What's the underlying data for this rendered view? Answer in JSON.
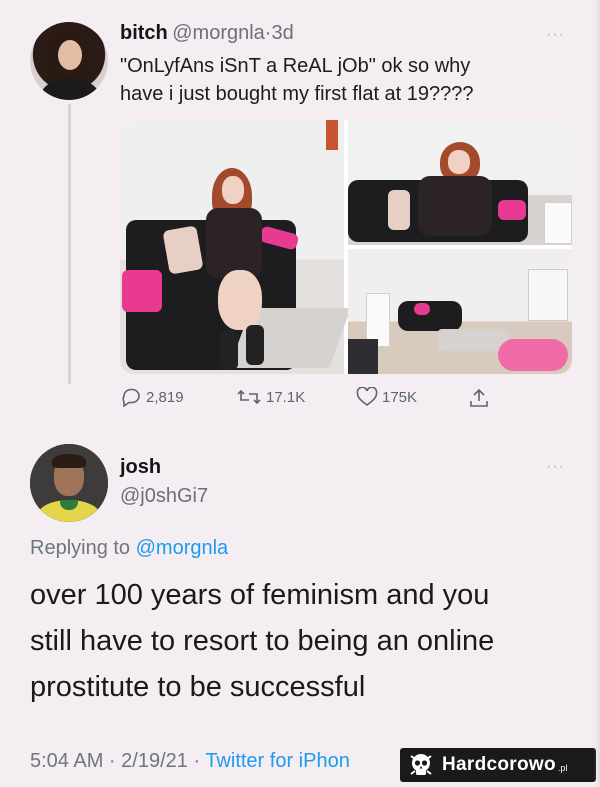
{
  "tweet": {
    "author_name": "bitch",
    "author_handle": "@morgnla",
    "separator": "·",
    "age": "3d",
    "more": "···",
    "text_line1": "\"OnLyfAns iSnT a ReAL jOb\" ok so why",
    "text_line2": "have i just bought my first flat at 19????",
    "stats": {
      "replies": "2,819",
      "retweets": "17.1K",
      "likes": "175K"
    }
  },
  "reply": {
    "author_name": "josh",
    "author_handle": "@j0shGi7",
    "more": "···",
    "replying_prefix": "Replying to",
    "replying_to": "@morgnla",
    "text_line1": "over 100 years of feminism and you",
    "text_line2": "still have to resort to being an online",
    "text_line3": "prostitute to be successful",
    "timestamp": "5:04 AM · 2/19/21 ·",
    "client": "Twitter for iPhon"
  },
  "watermark": {
    "text": "Hardcorowo",
    "suffix": ".pl"
  },
  "colors": {
    "background": "#f4eef2",
    "link": "#1d9bf0",
    "muted": "#6e767d"
  },
  "icons": [
    "reply-icon",
    "retweet-icon",
    "like-icon",
    "share-icon",
    "skull-icon"
  ]
}
